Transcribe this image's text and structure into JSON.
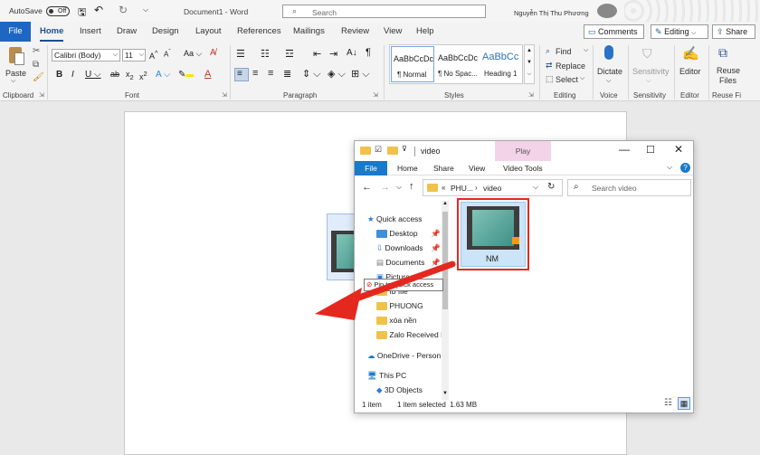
{
  "word": {
    "autosave_label": "AutoSave",
    "autosave_state": "Off",
    "doc_title": "Document1 - Word",
    "search_placeholder": "Search",
    "user_name": "Nguyễn Thị Thu Phương",
    "tabs": [
      "File",
      "Home",
      "Insert",
      "Draw",
      "Design",
      "Layout",
      "References",
      "Mailings",
      "Review",
      "View",
      "Help"
    ],
    "comments_label": "Comments",
    "editing_label": "Editing",
    "share_label": "Share",
    "clipboard": {
      "paste": "Paste",
      "group": "Clipboard"
    },
    "font": {
      "name": "Calibri (Body)",
      "size": "11",
      "group": "Font"
    },
    "paragraph_group": "Paragraph",
    "styles": {
      "items": [
        {
          "preview": "AaBbCcDc",
          "name": "¶ Normal"
        },
        {
          "preview": "AaBbCcDc",
          "name": "¶ No Spac..."
        },
        {
          "preview": "AaBbCc",
          "name": "Heading 1"
        }
      ],
      "group": "Styles"
    },
    "editing_group": {
      "find": "Find",
      "replace": "Replace",
      "select": "Select",
      "group": "Editing"
    },
    "voice": {
      "dictate": "Dictate",
      "group": "Voice"
    },
    "sensitivity": {
      "btn": "Sensitivity",
      "group": "Sensitivity"
    },
    "editor": {
      "btn": "Editor",
      "group": "Editor"
    },
    "reuse": {
      "btn1": "Reuse",
      "btn2": "Files",
      "group": "Reuse Fi"
    }
  },
  "explorer": {
    "title": "video",
    "play_tab": "Play",
    "tabs": [
      "File",
      "Home",
      "Share",
      "View",
      "Video Tools"
    ],
    "path": [
      "PHU...",
      "video"
    ],
    "search_placeholder": "Search video",
    "nav": [
      {
        "label": "Quick access",
        "type": "star"
      },
      {
        "label": "Desktop",
        "type": "folder-blue",
        "pin": true
      },
      {
        "label": "Downloads",
        "type": "download",
        "pin": true
      },
      {
        "label": "Documents",
        "type": "doc",
        "pin": true
      },
      {
        "label": "Pictures",
        "type": "pic"
      },
      {
        "label": "fb file",
        "type": "folder"
      },
      {
        "label": "PHUONG",
        "type": "folder"
      },
      {
        "label": "xóa nền",
        "type": "folder"
      },
      {
        "label": "Zalo Received Fi",
        "type": "folder"
      },
      {
        "label": "OneDrive - Person",
        "type": "cloud"
      },
      {
        "label": "This PC",
        "type": "pc"
      },
      {
        "label": "3D Objects",
        "type": "cube"
      }
    ],
    "file_name": "NM",
    "drag_tooltip": "Pin to Quick access",
    "status_count": "1 item",
    "status_selected": "1 item selected  1.63 MB"
  },
  "colors": {
    "word_blue": "#2b579a",
    "file_tab": "#1e66c3",
    "highlight_red": "#e4281f",
    "play_pink": "#f3d3e8"
  }
}
